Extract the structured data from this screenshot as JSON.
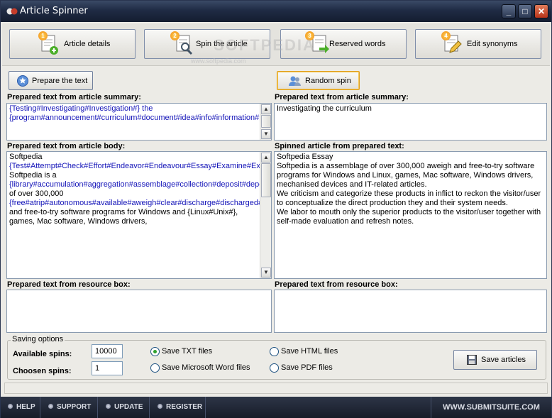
{
  "window": {
    "title": "Article Spinner"
  },
  "steps": [
    {
      "num": "1",
      "label": "Article details"
    },
    {
      "num": "2",
      "label": "Spin the article"
    },
    {
      "num": "3",
      "label": "Reserved words"
    },
    {
      "num": "4",
      "label": "Edit synonyms"
    }
  ],
  "watermark": {
    "big": "SOFTPEDIA",
    "small": "www.softpedia.com"
  },
  "left": {
    "prepare_button": "Prepare the text",
    "summary_label": "Prepared text from article summary:",
    "summary_text": "{Testing#Investigating#Investigation#} the {program#announcement#curriculum#document#idea#info#information#package#papers#performance#programme#promulgation#schedule#show#software#syllabus#system#thought#}",
    "body_label": "Prepared text from article body:",
    "body_line1": "Softpedia",
    "body_spin1": "{Test#Attempt#Check#Effort#Endeavor#Endeavour#Essay#Examine#Experiment#Experimentation#Judge#Prove#Run#Trial#Try#Tryout#}",
    "body_line2": "Softpedia is a",
    "body_spin2": "{library#accumulation#aggregation#assemblage#collection#deposit#depository#repository#}",
    "body_line3": " of over 300,000",
    "body_spin3": "{free#atrip#autonomous#available#aweigh#clear#discharge#discharged#disembarrass#disengage#disentangled#emancipated#escaped#extricated#footloose#freeborn#freed#independent#inexact#issue#liberal#liberate#liberated#loose#people#release#released#remove#slaveless#sovereign#supply#take#unbound#uncommitted#unconfined#unconstrained#unfixed#unhampered#unimprisoned#unloose#unloosen#unoccupied#unrestrained#unrestricted#withdraw#}",
    "body_line4": " and free-to-try software programs for Windows and {Linux#Unix#}, games, Mac software, Windows drivers,",
    "resource_label": "Prepared text from resource box:"
  },
  "right": {
    "random_button": "Random spin",
    "summary_label": "Prepared text from article summary:",
    "summary_text": "Investigating the curriculum",
    "spinned_label": "Spinned article from prepared text:",
    "spinned_lines": [
      "Softpedia Essay",
      "Softpedia is a assemblage of over 300,000 aweigh and free-to-try software programs for Windows and Linux, games, Mac software, Windows drivers, mechanised devices and IT-related articles.",
      "We criticism and categorize these products in inflict to reckon the visitor/user to conceptualize the direct production they and their system needs.",
      "We labor to mouth only the superior products to the visitor/user together with self-made evaluation and refresh notes."
    ],
    "resource_label": "Prepared text from resource box:"
  },
  "saving": {
    "legend": "Saving options",
    "available_label": "Available spins:",
    "available_value": "10000",
    "chosen_label": "Choosen spins:",
    "chosen_value": "1",
    "opt_txt": "Save TXT files",
    "opt_word": "Save Microsoft Word files",
    "opt_html": "Save HTML files",
    "opt_pdf": "Save PDF files",
    "selected": "txt",
    "save_button": "Save articles"
  },
  "footer": {
    "help": "HELP",
    "support": "SUPPORT",
    "update": "UPDATE",
    "register": "REGISTER",
    "site": "WWW.SUBMITSUITE.COM"
  }
}
